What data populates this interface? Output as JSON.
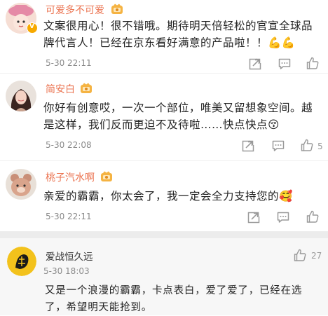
{
  "comments": [
    {
      "username": "可爱多不可爱",
      "text": "文案很用心！很不错哦。期待明天倍轻松的官宣全球品牌代言人！已经在京东看好满意的产品啦！！💪💪",
      "time": "5-30 22:11",
      "like_count": "",
      "avatar_icon": "pink-hat-avatar",
      "verified": true
    },
    {
      "username": "简安白",
      "text": "你好有创意哎，一次一个部位，唯美又留想象空间。越是这样，我们反而更迫不及待啦……快点快点😚",
      "time": "5-30 22:08",
      "like_count": "5",
      "avatar_icon": "girl-photo-avatar",
      "verified": false
    },
    {
      "username": "桃子汽水啊",
      "text": "亲爱的霸霸，你太会了，我一定会全力支持您的🥰",
      "time": "5-30 22:11",
      "like_count": "",
      "avatar_icon": "plush-toy-avatar",
      "verified": false
    },
    {
      "username": "爱战恒久远",
      "text": "又是一个浪漫的霸霸，卡点表白，爱了爱了，已经在选了，希望明天能抢到。",
      "time": "5-30 18:03",
      "like_count": "27",
      "avatar_icon": "ink-logo-avatar",
      "verified": false
    }
  ],
  "icons": {
    "share": "share-icon",
    "comment": "comment-icon",
    "like": "like-icon",
    "vip": "vip-crown-badge-icon"
  },
  "colors": {
    "username": "#eb7350",
    "time": "#8a8a8a",
    "icon": "#9a9a9a"
  }
}
